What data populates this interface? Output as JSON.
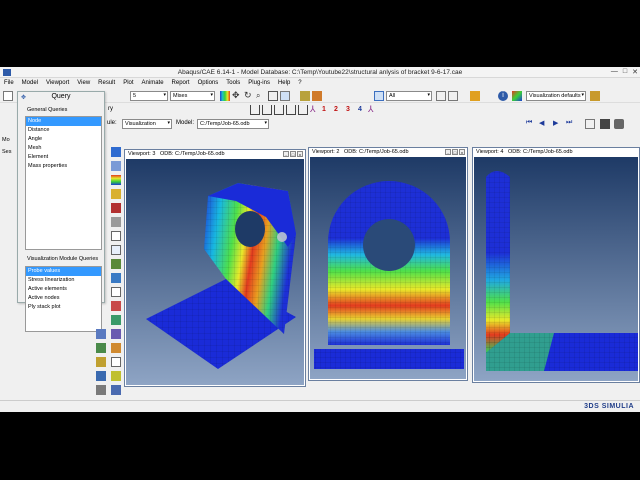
{
  "window": {
    "title": "Abaqus/CAE 6.14-1 - Model Database: C:\\Temp\\Youtube22\\structural anlysis of bracket 9-6-17.cae",
    "controls": [
      "—",
      "□",
      "✕"
    ]
  },
  "menu": [
    "File",
    "Model",
    "Viewport",
    "View",
    "Result",
    "Plot",
    "Animate",
    "Report",
    "Options",
    "Tools",
    "Plug-ins",
    "Help",
    "?"
  ],
  "toolbar": {
    "step_frame_field": "5",
    "variable": "Mises",
    "ry_label": "ry",
    "selection_filter": "All",
    "visualization_defaults": "Visualization defaults",
    "module_label": "ule:",
    "module": "Visualization",
    "model_label": "Model:",
    "model": "C:/Temp/Job-65.odb",
    "numbers": [
      "1",
      "2",
      "3",
      "4"
    ]
  },
  "query_dialog": {
    "title": "Query",
    "general_label": "General Queries",
    "general_items": [
      "Node",
      "Distance",
      "Angle",
      "Mesh",
      "Element",
      "Mass properties"
    ],
    "general_selected": 0,
    "vis_label": "Visualization Module Queries",
    "vis_items": [
      "Probe values",
      "Stress linearization",
      "Active elements",
      "Active nodes",
      "Ply stack plot"
    ],
    "vis_selected": 0
  },
  "left_strip": {
    "labels": [
      "Mo",
      "Ses"
    ]
  },
  "viewports": [
    {
      "title": "Viewport: 3",
      "odb": "ODB: C:/Temp/Job-65.odb"
    },
    {
      "title": "Viewport: 2",
      "odb": "ODB: C:/Temp/Job-65.odb"
    },
    {
      "title": "Viewport: 4",
      "odb": "ODB: C:/Temp/Job-65.odb"
    }
  ],
  "brand": "3DS SIMULIA"
}
